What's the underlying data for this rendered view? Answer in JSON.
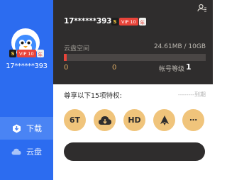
{
  "sidebar": {
    "username": "17******393",
    "badges": {
      "s": "S",
      "vip": "VIP 10",
      "year": "年"
    },
    "nav": [
      {
        "label": "下载",
        "icon": "download-icon",
        "active": true
      },
      {
        "label": "云盘",
        "icon": "cloud-icon",
        "active": false
      }
    ]
  },
  "header": {
    "username": "17******393",
    "badges": {
      "s": "S",
      "vip": "VIP 10",
      "year": "年"
    },
    "storage_label": "云盘空间",
    "storage_value": "24.61MB / 10GB",
    "storage_used_fraction": 0.0024,
    "stat_1": "0",
    "stat_2": "0",
    "account_level_label": "帐号等级",
    "account_level_value": "1"
  },
  "privileges": {
    "title": "尊享以下15项特权:",
    "expire_text": "--------到期",
    "items": [
      {
        "label": "6T",
        "icon": "6t-icon"
      },
      {
        "label": "",
        "icon": "cloud-download-icon"
      },
      {
        "label": "HD",
        "icon": "hd-icon"
      },
      {
        "label": "",
        "icon": "speedup-icon"
      },
      {
        "label": "⋯",
        "icon": "more-icon"
      }
    ]
  },
  "colors": {
    "sidebar": "#2c6cf0",
    "header": "#2f2d2d",
    "accent_gold": "#f0c47b",
    "vip_red": "#e8443a"
  }
}
